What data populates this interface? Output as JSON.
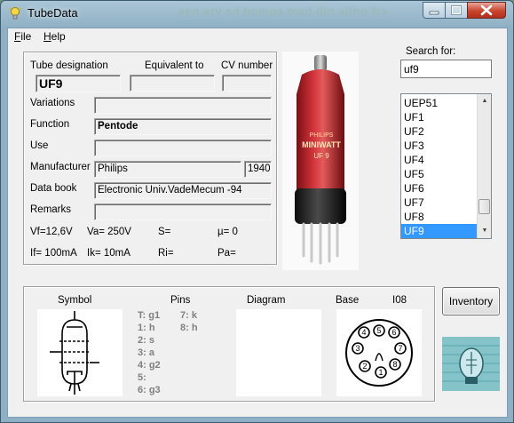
{
  "window": {
    "title": "TubeData",
    "background_title": "aen arv sd hompa mad din altho fra"
  },
  "menu": [
    {
      "label": "File",
      "key": "F",
      "rest": "ile"
    },
    {
      "label": "Help",
      "key": "H",
      "rest": "elp"
    }
  ],
  "details": {
    "tube_designation_label": "Tube designation",
    "equivalent_to_label": "Equivalent to",
    "cv_number_label": "CV number",
    "tube_designation": "UF9",
    "equivalent_to": "",
    "cv_number": "",
    "variations_label": "Variations",
    "variations": "",
    "function_label": "Function",
    "function": "Pentode",
    "use_label": "Use",
    "use": "",
    "manufacturer_label": "Manufacturer",
    "manufacturer": "Philips",
    "year": "1940",
    "data_book_label": "Data book",
    "data_book": "Electronic Univ.VadeMecum -94",
    "remarks_label": "Remarks",
    "remarks": ""
  },
  "ratings": {
    "vf": "Vf=12,6V",
    "va": "Va=  250V",
    "s": "S=",
    "mu": "µ=    0",
    "if": "If= 100mA",
    "ik": "Ik=   10mA",
    "ri": "Ri=",
    "pa": "Pa="
  },
  "tube_photo": {
    "brand_top": "PHILIPS",
    "brand_main": "MINIWATT",
    "type_mark": "UF 9"
  },
  "search": {
    "label": "Search for:",
    "value": "uf9"
  },
  "tube_list": {
    "items": [
      "UEP51",
      "UF1",
      "UF2",
      "UF3",
      "UF4",
      "UF5",
      "UF6",
      "UF7",
      "UF8",
      "UF9"
    ],
    "selected": "UF9"
  },
  "bottom": {
    "symbol_label": "Symbol",
    "pins_label": "Pins",
    "diagram_label": "Diagram",
    "base_label": "Base",
    "base_type": "I08",
    "pins_col1": [
      "T: g1",
      "1: h",
      "2: s",
      "3: a",
      "4: g2",
      "5:",
      "6: g3"
    ],
    "pins_col2": [
      "7: k",
      "8: h"
    ],
    "base_pins": [
      "1",
      "2",
      "3",
      "4",
      "5",
      "6",
      "7",
      "8"
    ]
  },
  "inventory_button": "Inventory"
}
